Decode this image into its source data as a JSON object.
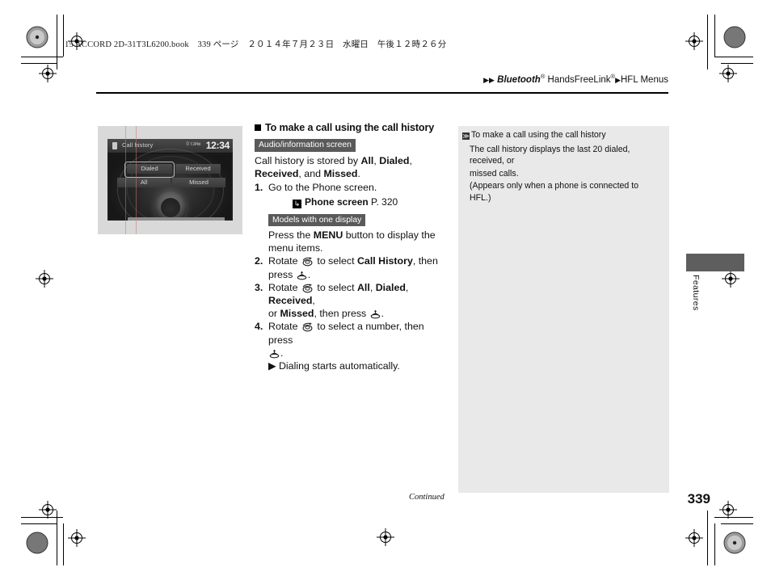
{
  "printer": {
    "imposition_line": "15 ACCORD 2D-31T3L6200.book　339 ページ　２０１４年７月２３日　水曜日　午後１２時２６分"
  },
  "header": {
    "arrows": "▶▶",
    "brand": "Bluetooth",
    "brand_sup": "®",
    "product": " HandsFreeLink",
    "product_sup": "®",
    "arrow_mid": "▶",
    "section": "HFL Menus"
  },
  "illustration": {
    "screen_title": "Call history",
    "signal": "0 ᴛᴊᴘᴍ",
    "clock": "12:34",
    "tiles": {
      "dialed": "Dialed",
      "received": "Received",
      "all": "All",
      "missed": "Missed"
    }
  },
  "main": {
    "heading": "To make a call using the call history",
    "chip_audio": "Audio/information screen",
    "intro_pre": "Call history is stored by ",
    "intro_all": "All",
    "intro_c1": ", ",
    "intro_dialed": "Dialed",
    "intro_c2": ", ",
    "intro_received": "Received",
    "intro_c3": ", and ",
    "intro_missed": "Missed",
    "intro_end": ".",
    "step1_num": "1.",
    "step1_text": "Go to the Phone screen.",
    "ref_icon": "↳",
    "ref_bold": "Phone screen",
    "ref_page": " P. 320",
    "chip_models": "Models with one display",
    "press_pre": "Press the ",
    "press_bold": "MENU",
    "press_post": " button to display the",
    "press_line2": "menu items.",
    "step2_num": "2.",
    "step2_a": "Rotate ",
    "step2_b": " to select ",
    "step2_bold": "Call History",
    "step2_c": ", then",
    "step2_line2_a": "press ",
    "step2_line2_b": ".",
    "step3_num": "3.",
    "step3_a": "Rotate ",
    "step3_b": " to select ",
    "step3_all": "All",
    "step3_c1": ", ",
    "step3_dialed": "Dialed",
    "step3_c2": ", ",
    "step3_received": "Received",
    "step3_c3": ",",
    "step3_line2_a": "or ",
    "step3_missed": "Missed",
    "step3_line2_b": ", then press ",
    "step3_line2_c": ".",
    "step4_num": "4.",
    "step4_a": "Rotate ",
    "step4_b": " to select a number, then press",
    "step4_line2": ".",
    "step4_arrow": "▶",
    "step4_result": "Dialing starts automatically."
  },
  "note": {
    "bullet": "≫",
    "title": "To make a call using the call history",
    "line1": "The call history displays the last 20 dialed, received, or",
    "line2": "missed calls.",
    "line3": "(Appears only when a phone is connected to HFL.)"
  },
  "tab": {
    "label": "Features"
  },
  "footer": {
    "continued": "Continued",
    "page_number": "339"
  },
  "colors": {
    "chip_gray": "#5a5a5a",
    "note_bg": "#e9e9e9",
    "tab_gray": "#5e5e5e",
    "illus_bg": "#d9d9d9"
  }
}
